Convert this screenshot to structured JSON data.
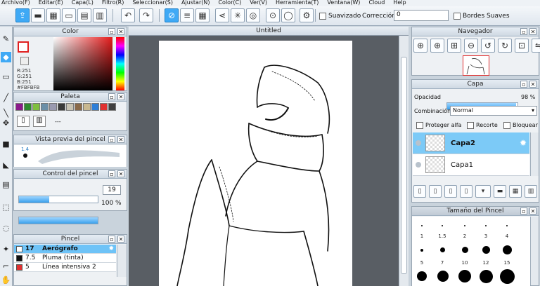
{
  "menu": [
    "Archivo(F)",
    "Editar(E)",
    "Capa(L)",
    "Filtro(R)",
    "Seleccionar(S)",
    "Ajustar(N)",
    "Color(C)",
    "Ver(V)",
    "Herramienta(T)",
    "Ventana(W)",
    "Cloud",
    "Help"
  ],
  "toolbar": {
    "suavizado_label": "Suavizado",
    "correccion_label": "Corrección",
    "correccion_value": "0",
    "bordes_label": "Bordes Suaves"
  },
  "color_panel": {
    "title": "Color",
    "r": "R:251",
    "g": "G:251",
    "b": "B:251",
    "hex": "#FBFBFB"
  },
  "palette_panel": {
    "title": "Paleta",
    "swatches": [
      "#8b1a8b",
      "#2e8b2e",
      "#7fbf3f",
      "#6a8fa8",
      "#9a9ab0",
      "#3a3a3a",
      "#c9c4b4",
      "#8a6a4a",
      "#c8b890",
      "#2e7fd8",
      "#e03030",
      "#404040"
    ],
    "dash": "---"
  },
  "brush_preview": {
    "title": "Vista previa del pincel",
    "size": "1.4"
  },
  "brush_control": {
    "title": "Control del pincel",
    "size_value": "19",
    "opacity_value": "100 %",
    "size_fill": 0.38,
    "opacity_fill": 1.0
  },
  "pincel": {
    "title": "Pincel",
    "items": [
      {
        "size": "17",
        "name": "Aerógrafo",
        "color": "#ffffff",
        "selected": true
      },
      {
        "size": "7.5",
        "name": "Pluma (tinta)",
        "color": "#111111",
        "selected": false
      },
      {
        "size": "5",
        "name": "Línea intensiva 2",
        "color": "#e03030",
        "selected": false
      }
    ]
  },
  "canvas": {
    "title": "Untitled"
  },
  "navegador": {
    "title": "Navegador"
  },
  "capa": {
    "title": "Capa",
    "opacidad_label": "Opacidad",
    "opacidad_value": "98 %",
    "opacidad_fill": 0.98,
    "combinacion_label": "Combinación",
    "combinacion_value": "Normal",
    "proteger_label": "Proteger alfa",
    "recorte_label": "Recorte",
    "bloquear_label": "Bloquear",
    "layers": [
      {
        "name": "Capa2",
        "selected": true
      },
      {
        "name": "Capa1",
        "selected": false
      }
    ]
  },
  "brush_size": {
    "title": "Tamaño del Pincel",
    "labels": [
      "1",
      "1.5",
      "2",
      "3",
      "4",
      "5",
      "7",
      "10",
      "12",
      "15"
    ]
  }
}
